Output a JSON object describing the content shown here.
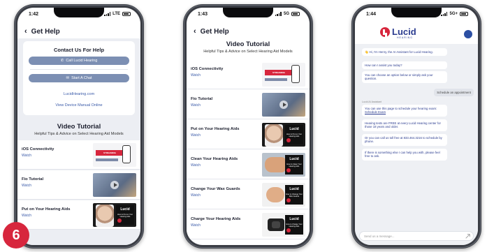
{
  "phones": [
    {
      "status_time": "1:42",
      "network": "LTE",
      "header_title": "Get Help",
      "contact": {
        "title": "Contact Us For Help",
        "call_label": "Call Lucid Hearing",
        "chat_label": "Start A Chat",
        "website_link": "LucidHearing.com",
        "manual_link": "View Device Manual Online"
      },
      "video_section": {
        "title": "Video Tutorial",
        "subtitle": "Helpful Tips & Advice on Select Hearing Aid Models"
      },
      "videos": [
        {
          "name": "iOS Connectivity",
          "action": "Watch"
        },
        {
          "name": "Fio Tutorial",
          "action": "Watch"
        },
        {
          "name": "Put on Your Hearing Aids",
          "action": "Watch"
        }
      ]
    },
    {
      "status_time": "1:43",
      "network": "5G",
      "header_title": "Get Help",
      "video_section": {
        "title": "Video Tutorial",
        "subtitle": "Helpful Tips & Advice on Select Hearing Aid Models"
      },
      "videos": [
        {
          "name": "iOS Connectivity",
          "action": "Watch"
        },
        {
          "name": "Fio Tutorial",
          "action": "Watch"
        },
        {
          "name": "Put on Your Hearing Aids",
          "action": "Watch"
        },
        {
          "name": "Clean Your Hearing Aids",
          "action": "Watch"
        },
        {
          "name": "Change Your Wax Guards",
          "action": "Watch"
        },
        {
          "name": "Charge Your Hearing Aids",
          "action": "Watch"
        }
      ]
    },
    {
      "status_time": "1:44",
      "network": "5G+",
      "brand": "Lucid",
      "brand_sub": "HEARING",
      "messages": [
        {
          "from": "bot",
          "text": "👋 Hi, I'm Henry, the AI Assistant for Lucid Hearing."
        },
        {
          "from": "bot",
          "text": "How can I assist you today?"
        },
        {
          "from": "bot",
          "text": "You can choose an option below or simply ask your question."
        },
        {
          "from": "user",
          "text": "Schedule an appointment"
        },
        {
          "from": "label",
          "text": "Lucid AI Assistant"
        },
        {
          "from": "bot",
          "text": "You can use this page to schedule your hearing exam:",
          "link": "Schedule Exam"
        },
        {
          "from": "bot",
          "text": "Hearing tests are FREE at every Lucid Hearing center for those 18 years and older."
        },
        {
          "from": "bot",
          "text": "Or you can call us toll free at 833.464.3216 to schedule by phone."
        },
        {
          "from": "bot",
          "text": "If there is something else I can help you with, please feel free to ask."
        }
      ],
      "input_placeholder": "Send us a message..."
    }
  ],
  "step_number": "6",
  "thumbnail_text": {
    "ios_banner": "STREAMING",
    "lucid_logo": "Lucid",
    "put_on": "How to Put on Your Hearing Aids",
    "clean": "How to Clean Your Hearing Aids",
    "wax": "How to Change Your Wax Guards",
    "charge": "How to Charge Your Hearing Aids"
  },
  "colors": {
    "brand_red": "#d7263d",
    "brand_blue": "#2a3b8f",
    "button_blue": "#7c8fb3",
    "link_blue": "#3b5ba9"
  }
}
